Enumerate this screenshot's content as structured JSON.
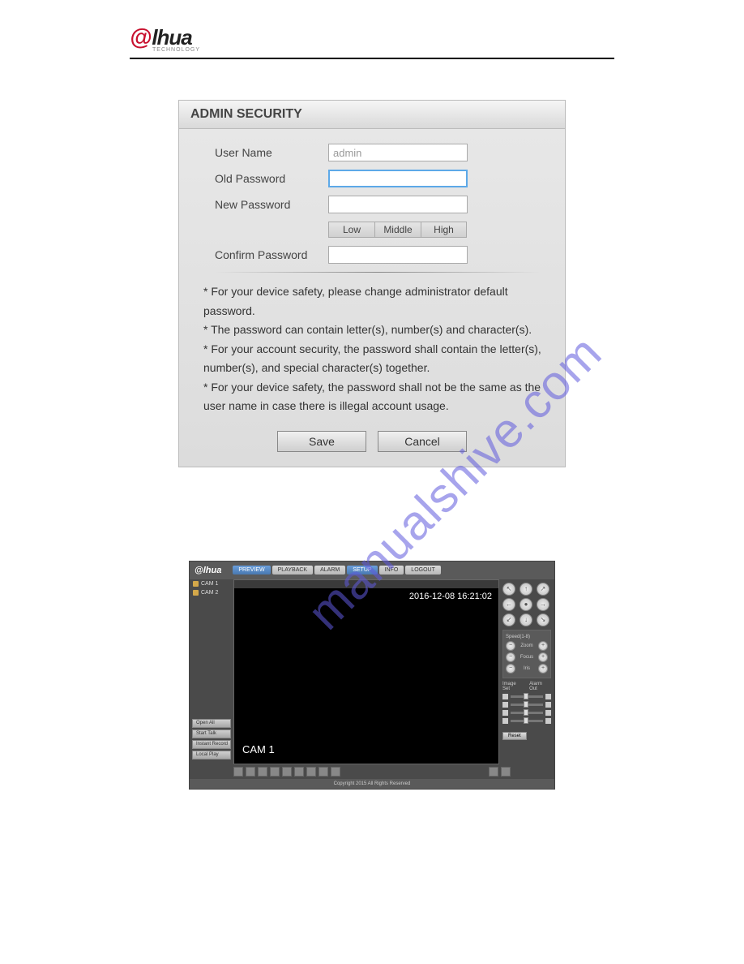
{
  "brand": {
    "logo_symbol": "@",
    "logo_text": "lhua",
    "logo_sub": "TECHNOLOGY"
  },
  "dialog": {
    "title": "ADMIN SECURITY",
    "fields": {
      "username_label": "User Name",
      "username_value": "admin",
      "oldpw_label": "Old Password",
      "newpw_label": "New Password",
      "confirmpw_label": "Confirm Password"
    },
    "strength": {
      "low": "Low",
      "middle": "Middle",
      "high": "High"
    },
    "notes": [
      "* For your device safety, please change administrator default password.",
      "* The password can contain letter(s), number(s) and character(s).",
      "* For your account security, the password shall contain the letter(s), number(s), and special character(s) together.",
      "* For your device safety, the password shall not be the same as the user name in case there is illegal account usage."
    ],
    "buttons": {
      "save": "Save",
      "cancel": "Cancel"
    }
  },
  "watermark": "manualshive.com",
  "nvr": {
    "logo": "@lhua",
    "tabs": [
      "PREVIEW",
      "PLAYBACK",
      "ALARM",
      "SETUP",
      "INFO",
      "LOGOUT"
    ],
    "tree": [
      "CAM 1",
      "CAM 2"
    ],
    "left_buttons": [
      "Open All",
      "Start Talk",
      "Instant Record",
      "Local Play"
    ],
    "video_bar": "",
    "timestamp": "2016-12-08 16:21:02",
    "cam_label": "CAM 1",
    "ptz_arrows": [
      "↖",
      "↑",
      "↗",
      "←",
      "●",
      "→",
      "↙",
      "↓",
      "↘"
    ],
    "ptz_speed_label": "Speed(1-8)",
    "ptz_controls": [
      "Zoom",
      "Focus",
      "Iris"
    ],
    "tabs_right": [
      "Image Set",
      "Alarm Out"
    ],
    "reset": "Reset",
    "footer": "Copyright 2015 All Rights Reserved"
  }
}
